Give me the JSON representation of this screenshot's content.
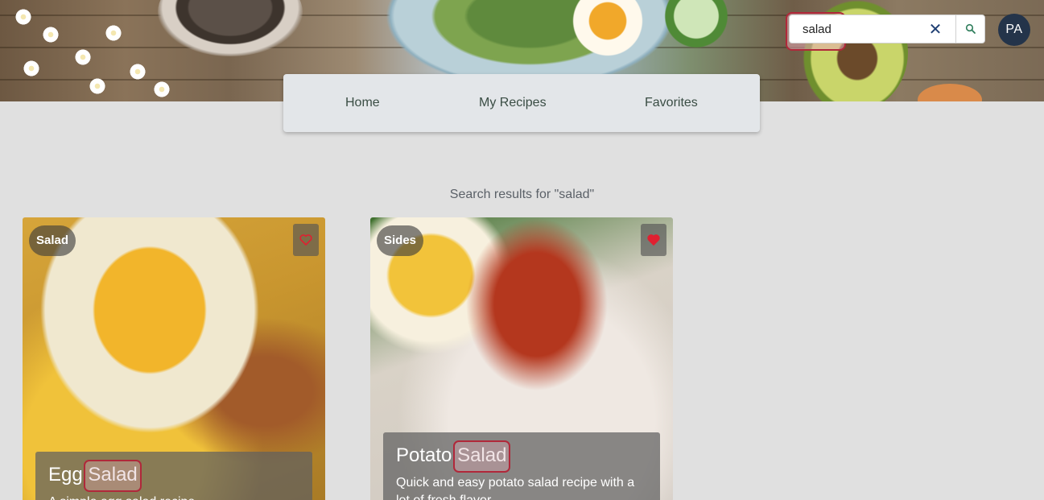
{
  "search": {
    "value": "salad",
    "clear_label": "✕"
  },
  "user": {
    "initials": "PA"
  },
  "nav": {
    "items": [
      "Home",
      "My Recipes",
      "Favorites"
    ]
  },
  "results": {
    "title": "Search results for \"salad\"",
    "cards": [
      {
        "category": "Salad",
        "title_prefix": "Egg ",
        "title_match": "Salad",
        "description": "A simple egg salad recipe...",
        "favorited": false
      },
      {
        "category": "Sides",
        "title_prefix": "Potato ",
        "title_match": "Salad",
        "description": "Quick and easy potato salad recipe with a lot of fresh flavor...",
        "favorited": true
      }
    ]
  },
  "colors": {
    "heart": "#e02030",
    "highlight_border": "#b0283a",
    "avatar": "#24344a"
  }
}
